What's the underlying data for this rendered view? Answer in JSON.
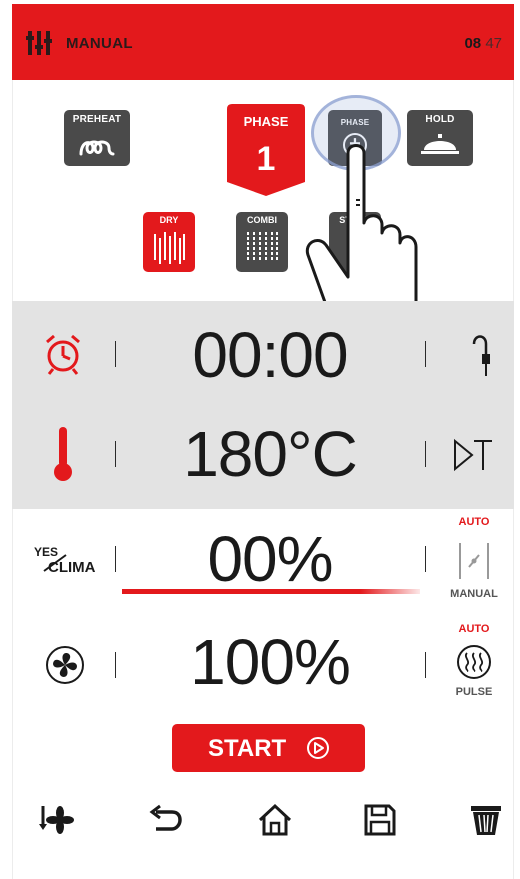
{
  "header": {
    "title": "MANUAL",
    "time_hours": "08",
    "time_minutes": "47"
  },
  "phase_buttons": {
    "preheat_label": "PREHEAT",
    "phase_label": "PHASE",
    "phase_number": "1",
    "add_phase_label": "PHASE",
    "add_phase_symbol": "+",
    "hold_label": "HOLD"
  },
  "cook_modes": {
    "dry_label": "DRY",
    "combi_label": "COMBI",
    "steam_label": "STEAM"
  },
  "settings": {
    "time_value": "00:00",
    "temperature_value": "180°C",
    "humidity_value": "00%",
    "fan_value": "100%"
  },
  "clima": {
    "line1": "YES",
    "line2": "CLIMA",
    "auto_label": "AUTO",
    "manual_label": "MANUAL"
  },
  "fan_mode": {
    "auto_label": "AUTO",
    "pulse_label": "PULSE"
  },
  "humidity_bar_fraction": 0.8,
  "start_button": {
    "label": "START"
  },
  "colors": {
    "accent": "#e3191c",
    "dark_button": "#4a4a4a",
    "panel": "#e3e3e3"
  },
  "icons": [
    "settings-sliders-icon",
    "preheat-coil-icon",
    "hold-cloche-icon",
    "alarm-clock-icon",
    "probe-icon",
    "thermometer-icon",
    "delta-t-icon",
    "fan-icon",
    "manual-valve-icon",
    "pulse-icon",
    "cooling-fan-icon",
    "back-arrow-icon",
    "home-icon",
    "save-icon",
    "trash-icon"
  ]
}
